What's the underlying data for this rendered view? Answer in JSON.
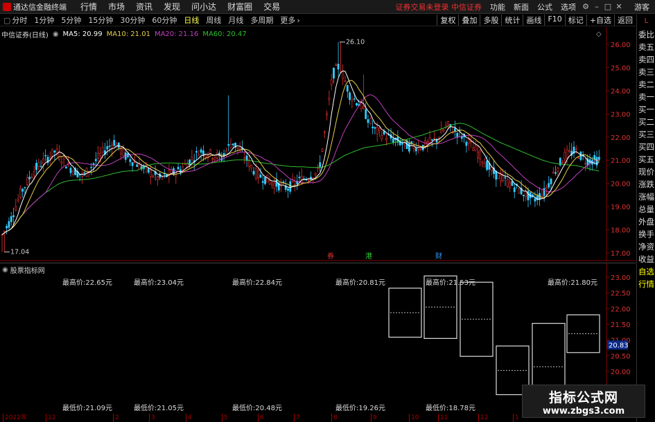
{
  "menu": {
    "app_title": "通达信金融终端",
    "items": [
      "行情",
      "市场",
      "资讯",
      "发现",
      "问小达",
      "财富圈",
      "交易"
    ],
    "status_warning": "证券交易未登录  中信证券",
    "right_items": [
      "功能",
      "新面",
      "公式",
      "选项"
    ],
    "guest": "游客"
  },
  "toolbar": {
    "periods": [
      "分时",
      "1分钟",
      "5分钟",
      "15分钟",
      "30分钟",
      "60分钟",
      "日线",
      "周线",
      "月线",
      "多周期",
      "更多"
    ],
    "active_period": "日线",
    "buttons": [
      "复权",
      "叠加",
      "多股",
      "统计",
      "画线",
      "F10",
      "标记",
      "+自选",
      "返回"
    ]
  },
  "side_tabs": [
    "委比",
    "卖五",
    "卖四",
    "卖三",
    "卖二",
    "卖一",
    "买一",
    "买二",
    "买三",
    "买四",
    "买五",
    "现价",
    "涨跌",
    "涨幅",
    "总量",
    "外盘",
    "换手",
    "净资",
    "收益",
    "自选",
    "行情"
  ],
  "side_badge": "L",
  "legend": {
    "stock": "中信证券(日线)",
    "ma5": "MA5: 20.99",
    "ma10": "MA10: 21.01",
    "ma20": "MA20: 21.16",
    "ma60": "MA60: 20.47"
  },
  "main_chart": {
    "y_ticks": [
      "26.00",
      "25.00",
      "24.00",
      "23.00",
      "22.00",
      "21.00",
      "20.00",
      "19.00",
      "18.00",
      "17.00"
    ],
    "high_label": "26.10",
    "low_label": "17.04",
    "markers": [
      {
        "text": "券",
        "color": "#e33"
      },
      {
        "text": "港",
        "color": "#3c3"
      },
      {
        "text": "财",
        "color": "#39f"
      }
    ]
  },
  "indicator": {
    "title": "股票指标网",
    "y_ticks": [
      "23.00",
      "22.50",
      "22.00",
      "21.50",
      "21.00",
      "20.50",
      "20.00"
    ],
    "current_value": "20.83",
    "highs": [
      "最高价:22.65元",
      "最高价:23.04元",
      "最高价:22.84元",
      "最高价:20.81元",
      "最高价:21.53元",
      "最高价:21.80元"
    ],
    "lows": [
      "最低价:21.09元",
      "最低价:21.05元",
      "最低价:20.48元",
      "最低价:19.26元",
      "最低价:18.78元"
    ]
  },
  "date_axis": {
    "labels": [
      "2022年",
      "12",
      "2",
      "3",
      "4",
      "5",
      "6",
      "7",
      "8",
      "9",
      "10",
      "11",
      "12",
      "1"
    ]
  },
  "watermark": {
    "title": "指标公式网",
    "url": "www.zbgs3.com"
  },
  "colors": {
    "up": "#e33",
    "down": "#3cf",
    "ma5": "#ffffff",
    "ma10": "#e6d24a",
    "ma20": "#c040c0",
    "ma60": "#2fbf2f"
  }
}
